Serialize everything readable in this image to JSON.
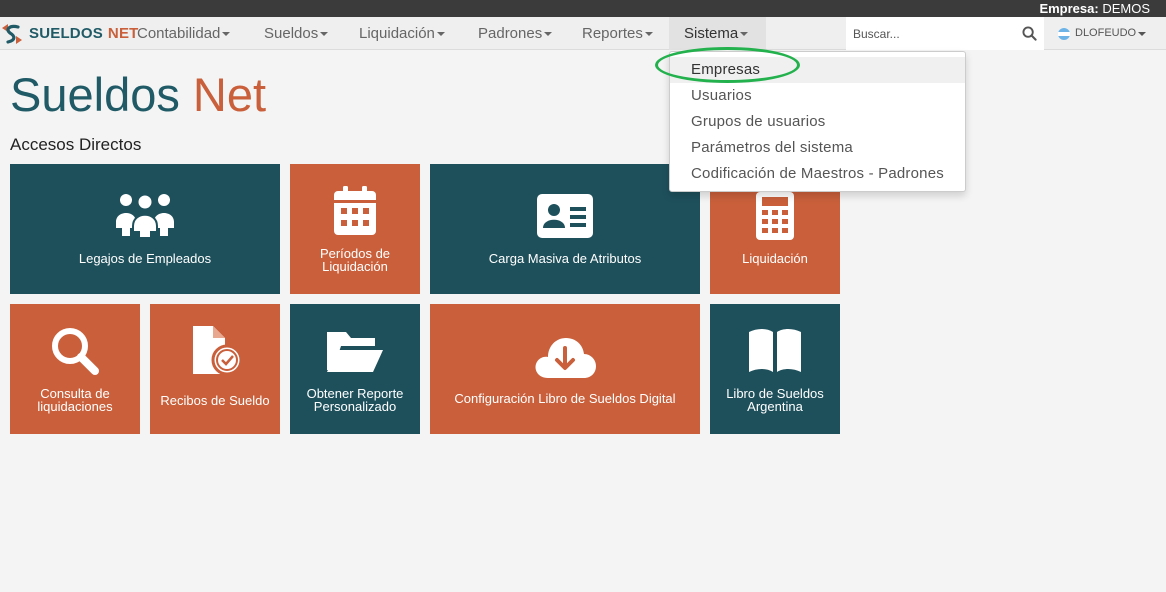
{
  "topbar": {
    "empresa_label": "Empresa:",
    "empresa_value": "DEMOS"
  },
  "brand": {
    "part1": "SUELDOS",
    "part2": "NET"
  },
  "nav": {
    "items": [
      {
        "label": "Contabilidad"
      },
      {
        "label": "Sueldos"
      },
      {
        "label": "Liquidación"
      },
      {
        "label": "Padrones"
      },
      {
        "label": "Reportes"
      },
      {
        "label": "Sistema"
      }
    ]
  },
  "search": {
    "placeholder": "Buscar..."
  },
  "user": {
    "name": "DLOFEUDO"
  },
  "dropdown": {
    "items": [
      {
        "label": "Empresas"
      },
      {
        "label": "Usuarios"
      },
      {
        "label": "Grupos de usuarios"
      },
      {
        "label": "Parámetros del sistema"
      },
      {
        "label": "Codificación de Maestros - Padrones"
      }
    ]
  },
  "title": {
    "part1": "Sueldos",
    "part2": "Net"
  },
  "accesos": {
    "heading": "Accesos Directos",
    "tiles": [
      {
        "label": "Legajos de Empleados",
        "icon": "users-icon"
      },
      {
        "label": "Períodos de Liquidación",
        "icon": "calendar-icon"
      },
      {
        "label": "Carga Masiva de Atributos",
        "icon": "id-card-icon"
      },
      {
        "label": "Liquidación",
        "icon": "calculator-icon"
      },
      {
        "label": "Consulta de liquidaciones",
        "icon": "search-icon"
      },
      {
        "label": "Recibos de Sueldo",
        "icon": "file-check-icon"
      },
      {
        "label": "Obtener Reporte Personalizado",
        "icon": "folder-open-icon"
      },
      {
        "label": "Configuración Libro de Sueldos Digital",
        "icon": "cloud-download-icon"
      },
      {
        "label": "Libro de Sueldos Argentina",
        "icon": "book-icon"
      }
    ]
  },
  "colors": {
    "teal": "#1e505c",
    "orange": "#c9603b",
    "highlight": "#23b14d"
  }
}
